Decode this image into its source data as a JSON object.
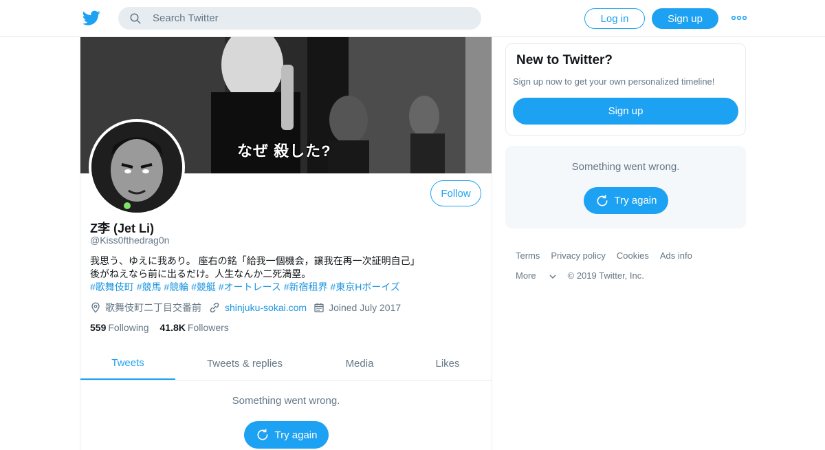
{
  "header": {
    "search_placeholder": "Search Twitter",
    "login_label": "Log in",
    "signup_label": "Sign up"
  },
  "profile": {
    "banner_caption": "なぜ 殺した?",
    "name": "Z李 (Jet Li)",
    "handle": "@Kiss0fthedrag0n",
    "follow_label": "Follow",
    "bio_line1": "我思う、ゆえに我あり。 座右の銘「給我一個機会，譲我在再一次証明自己」",
    "bio_line2": "後がねえなら前に出るだけ。人生なんか二死満塁。",
    "bio_tags": [
      "#歌舞伎町",
      "#競馬",
      "#競輪",
      "#競艇",
      "#オートレース",
      "#新宿租界",
      "#東京Hボーイズ"
    ],
    "location": "歌舞伎町二丁目交番前",
    "website": "shinjuku-sokai.com",
    "joined": "Joined July 2017",
    "following_count": "559",
    "following_label": "Following",
    "followers_count": "41.8K",
    "followers_label": "Followers"
  },
  "tabs": [
    "Tweets",
    "Tweets & replies",
    "Media",
    "Likes"
  ],
  "main_error": {
    "message": "Something went wrong.",
    "button": "Try again"
  },
  "sidebar": {
    "new_title": "New to Twitter?",
    "new_sub": "Sign up now to get your own personalized timeline!",
    "signup_label": "Sign up",
    "error_message": "Something went wrong.",
    "try_again": "Try again"
  },
  "footer": {
    "links": [
      "Terms",
      "Privacy policy",
      "Cookies",
      "Ads info"
    ],
    "more": "More",
    "copyright": "© 2019 Twitter, Inc."
  },
  "colors": {
    "accent": "#1da1f2",
    "link": "#1b95e0",
    "muted": "#657786"
  },
  "icons": [
    "twitter-bird-icon",
    "search-icon",
    "more-dots-icon",
    "location-icon",
    "link-icon",
    "calendar-icon",
    "refresh-icon",
    "chevron-down-icon"
  ]
}
